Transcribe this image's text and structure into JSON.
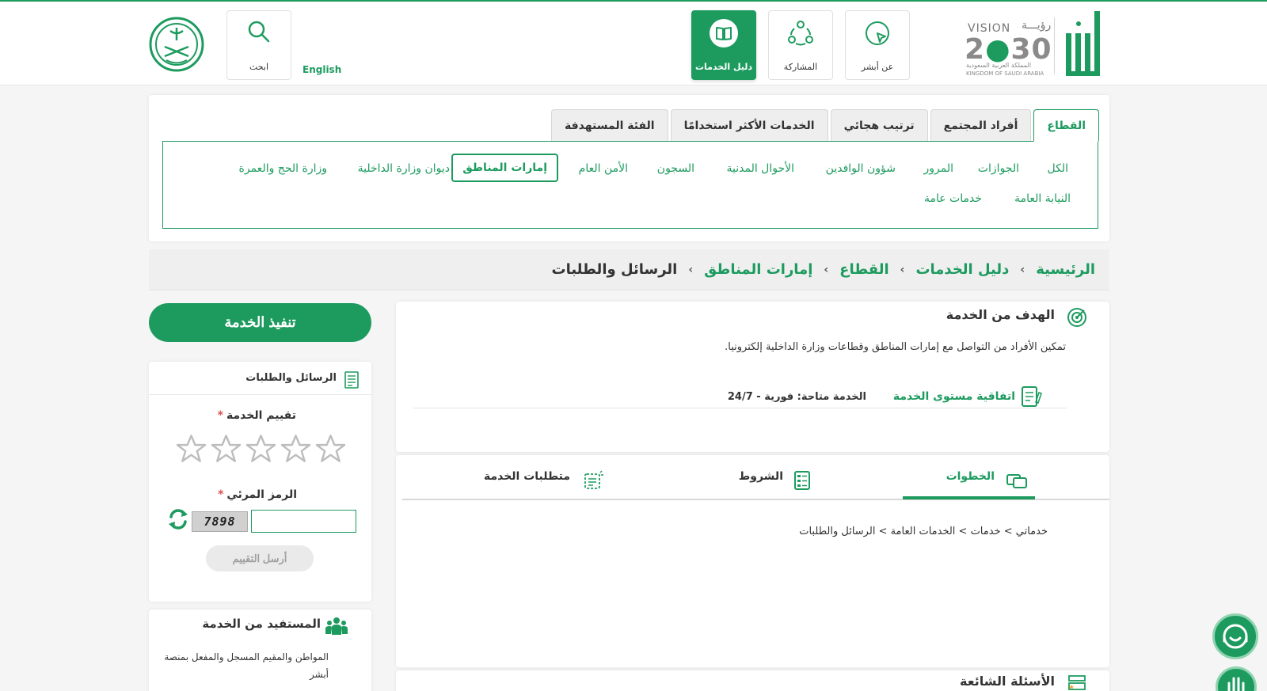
{
  "header": {
    "nav": [
      {
        "key": "about",
        "label": "عن أبشر",
        "icon": "location-icon"
      },
      {
        "key": "participation",
        "label": "المشاركة",
        "icon": "participation-icon"
      },
      {
        "key": "services_guide",
        "label": "دليل الخدمات",
        "icon": "book-icon"
      }
    ],
    "search_label": "ابحث",
    "language_link": "English",
    "vision": {
      "word": "VISION",
      "arabic": "رؤيـــة",
      "year_left": "2",
      "year_right": "30",
      "country_ar": "المملكة العربية السعودية",
      "country_en": "KINGDOM OF SAUDI ARABIA"
    }
  },
  "filter": {
    "tabs": [
      "القطاع",
      "أفراد المجتمع",
      "ترتيب هجائي",
      "الخدمات الأكثر استخدامًا",
      "الفئة المستهدفة"
    ],
    "sectors": [
      "الكل",
      "الجوازات",
      "المرور",
      "شؤون الوافدين",
      "الأحوال المدنية",
      "السجون",
      "الأمن العام",
      "إمارات المناطق",
      "ديوان وزارة الداخلية",
      "وزارة الحج والعمرة",
      "النيابة العامة",
      "خدمات عامة"
    ]
  },
  "breadcrumb": [
    "الرئيسية",
    "دليل الخدمات",
    "القطاع",
    "إمارات المناطق",
    "الرسائل والطلبات"
  ],
  "goal": {
    "title": "الهدف من الخدمة",
    "description": "تمكين الأفراد من التواصل مع إمارات المناطق وقطاعات وزارة الداخلية إلكترونيا.",
    "sla_title": "اتفاقية مستوى الخدمة",
    "availability": "الخدمة متاحة: فورية - 24/7"
  },
  "steps": {
    "tabs": [
      "الخطوات",
      "الشروط",
      "متطلبات الخدمة"
    ],
    "path": "خدماتي > خدمات > الخدمات العامة > الرسائل والطلبات"
  },
  "faq_title": "الأسئلة الشائعة",
  "sidebar": {
    "execute_button": "تنفيذ الخدمة",
    "rating_card_title": "الرسائل والطلبات",
    "rating_label": "تقييم الخدمة",
    "captcha_label": "الرمز المرئي",
    "required_mark": "*",
    "captcha_code": "7898",
    "stars_total": 5,
    "stars_selected": 0,
    "send_button": "أرسل التقييم",
    "beneficiary_title": "المستفيد من الخدمة",
    "beneficiary_text": "المواطن والمقيم المسجل والمفعل بمنصة أبشر"
  },
  "colors": {
    "brand_green": "#1d9b5f",
    "star_gray": "#bdbdbd",
    "required_red": "#d9534f"
  }
}
